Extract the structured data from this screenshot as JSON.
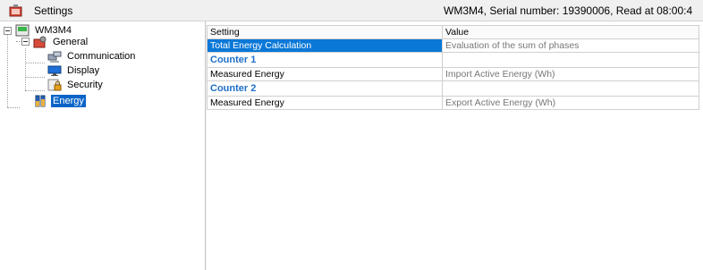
{
  "window": {
    "title": "Settings",
    "device_info": "WM3M4, Serial number: 19390006, Read at 08:00:4"
  },
  "tree": {
    "root": {
      "label": "WM3M4",
      "icon": "meter-icon"
    },
    "general": {
      "label": "General",
      "icon": "settings-icon"
    },
    "children": [
      {
        "label": "Communication",
        "icon": "network-icon"
      },
      {
        "label": "Display",
        "icon": "monitor-icon"
      },
      {
        "label": "Security",
        "icon": "lock-icon"
      }
    ],
    "energy": {
      "label": "Energy",
      "icon": "battery-icon",
      "selected": true
    }
  },
  "grid": {
    "headers": {
      "setting": "Setting",
      "value": "Value"
    },
    "rows": [
      {
        "type": "row",
        "setting": "Total Energy Calculation",
        "value": "Evaluation of the sum of phases",
        "selected": true
      },
      {
        "type": "category",
        "setting": "Counter 1",
        "value": ""
      },
      {
        "type": "row",
        "setting": "Measured Energy",
        "value": "Import Active Energy (Wh)"
      },
      {
        "type": "category",
        "setting": "Counter 2",
        "value": ""
      },
      {
        "type": "row",
        "setting": "Measured Energy",
        "value": "Export Active Energy (Wh)"
      }
    ]
  },
  "colors": {
    "selection": "#0a78d7",
    "category_text": "#1e6fc8"
  }
}
